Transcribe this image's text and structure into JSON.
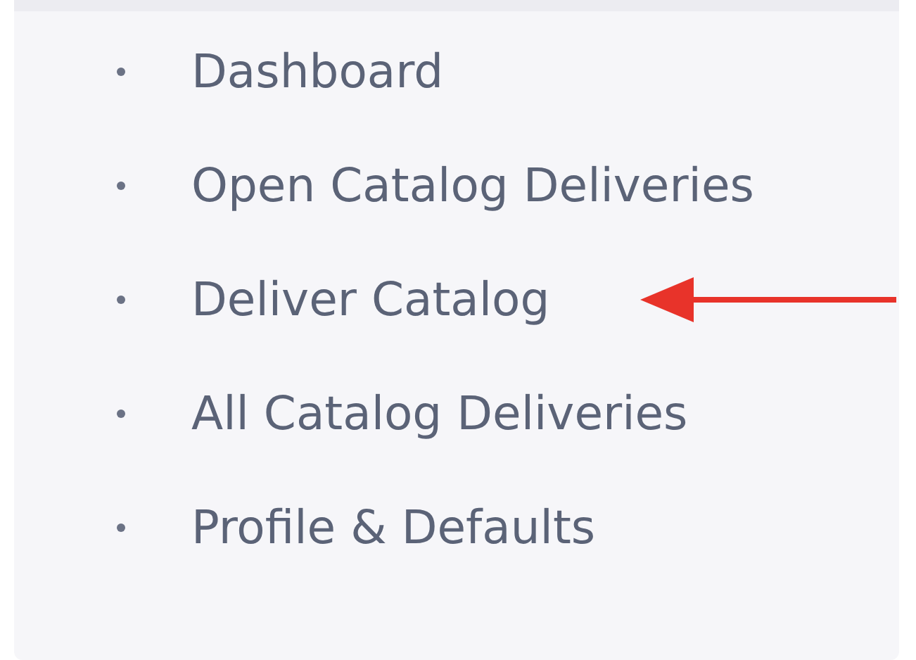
{
  "menu": {
    "items": [
      {
        "label": "Dashboard",
        "arrow": false
      },
      {
        "label": "Open Catalog Deliveries",
        "arrow": false
      },
      {
        "label": "Deliver Catalog",
        "arrow": true
      },
      {
        "label": "All Catalog Deliveries",
        "arrow": false
      },
      {
        "label": "Profile & Defaults",
        "arrow": false
      }
    ]
  }
}
